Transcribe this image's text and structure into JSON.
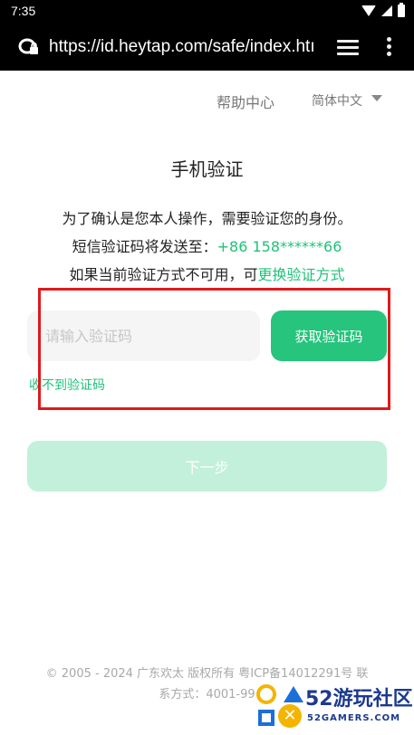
{
  "status_bar": {
    "time": "7:35"
  },
  "browser": {
    "url": "https://id.heytap.com/safe/index.htı"
  },
  "header": {
    "help_label": "帮助中心",
    "language": "简体中文"
  },
  "main": {
    "title": "手机验证",
    "line1": "为了确认是您本人操作，需要验证您的身份。",
    "line2_prefix": "短信验证码将发送至：",
    "phone": "+86 158******66",
    "line3_prefix": "如果当前验证方式不可用，可",
    "change_method_link": "更换验证方式",
    "code_input_placeholder": "请输入验证码",
    "code_input_value": "",
    "get_code_button": "获取验证码",
    "no_code_link": "收不到验证码",
    "next_button": "下一步"
  },
  "footer": {
    "line1": "© 2005 - 2024 广东欢太 版权所有 粤ICP备14012291号 联",
    "line2": "系方式：4001-99"
  },
  "watermark": {
    "text": "52游玩社区",
    "subtext": "52GAMERS.COM"
  },
  "colors": {
    "accent": "#26c47c",
    "accent_disabled": "#c2f0da",
    "highlight": "#e0191b"
  }
}
